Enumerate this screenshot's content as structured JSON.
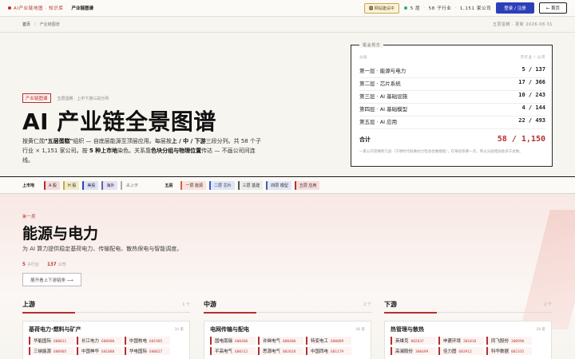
{
  "topbar": {
    "brand": "AI产业链地图 · 知识库",
    "map_label": "产业链图谱",
    "live_badge": "🅼 网站建设中",
    "stats": [
      "5 层",
      "58 子行业",
      "1,151 家公司"
    ],
    "login_label": "登录 / 注册",
    "back_label": "← 首页"
  },
  "breadcrumb": {
    "home": "首页",
    "current": "产业链图谱",
    "right": "五层蛋糕 · 更新 2026·08·31"
  },
  "hero": {
    "tag": "产业链图谱",
    "subtitle": "五层蛋糕 · 上中下游三段分列",
    "title": "AI 产业链全景图谱",
    "desc_parts": [
      "按黄仁勋",
      "\"五层蛋糕\"",
      "组织 — 自底层能源至顶层应用。每层按",
      "上 / 中 / 下游",
      "三段分列。共 58 个子行业 × 1,151 家公司。按 ",
      "5 种上市地",
      "染色。关系靠",
      "色块分组与物理位置",
      "传达 — 不画公司间连线。"
    ]
  },
  "card": {
    "label": "覆盖概览",
    "head_left": "分层",
    "head_right": "子行业 / 公司",
    "rows": [
      {
        "name": "第一层 · 能源与电力",
        "value": "5 / 137"
      },
      {
        "name": "第二层 · 芯片系统",
        "value": "17 / 366"
      },
      {
        "name": "第三层 · AI 基础设施",
        "value": "10 / 243"
      },
      {
        "name": "第四层 · AI 基础模型",
        "value": "4 / 144"
      },
      {
        "name": "第五层 · AI 应用",
        "value": "22 / 493"
      }
    ],
    "total_label": "合计",
    "total_value": "58 / 1,150",
    "note": "一家公司常横跨几层（宁德时代既做动力电池也做储能），在每层各算一次，所以分层相加会多于总数。"
  },
  "filter": {
    "market_title": "上市地",
    "markets": [
      "A 股",
      "H 股",
      "美股",
      "海外",
      "未上市"
    ],
    "layer_title": "五层",
    "layers": [
      "一层 能源",
      "二层 芯片",
      "三层 基建",
      "四层 模型",
      "五层 应用"
    ]
  },
  "section": {
    "kicker": "第一层",
    "title": "能源与电力",
    "desc": "为 AI 算力提供稳定基荷电力、传输配电、散热保电与智能调度。",
    "sub_count": "5",
    "sub_label": "子行业",
    "co_count": "137",
    "co_label": "公司",
    "button": "展开看上下游链条 ⟶",
    "columns": [
      {
        "title": "上游",
        "count": "1 个",
        "group": {
          "title": "基荷电力·燃料与矿产",
          "num": "34 家",
          "companies": [
            {
              "name": "华能国际",
              "code": "600011"
            },
            {
              "name": "长江电力",
              "code": "600900"
            },
            {
              "name": "中国核电",
              "code": "601985"
            },
            {
              "name": "三峡能源",
              "code": "600905"
            },
            {
              "name": "中国神华",
              "code": "601088"
            },
            {
              "name": "华电国际",
              "code": "600027"
            }
          ]
        }
      },
      {
        "title": "中游",
        "count": "2 个",
        "group": {
          "title": "电网传输与配电",
          "num": "48 家",
          "companies": [
            {
              "name": "国电南瑞",
              "code": "600406"
            },
            {
              "name": "许继电气",
              "code": "000400"
            },
            {
              "name": "特变电工",
              "code": "600089"
            },
            {
              "name": "平高电气",
              "code": "600312"
            },
            {
              "name": "思源电气",
              "code": "002028"
            },
            {
              "name": "中国西电",
              "code": "601179"
            }
          ]
        }
      },
      {
        "title": "下游",
        "count": "2 个",
        "group": {
          "title": "热管理与散热",
          "num": "28 家",
          "companies": [
            {
              "name": "英维克",
              "code": "002837"
            },
            {
              "name": "申菱环境",
              "code": "301018"
            },
            {
              "name": "同飞股份",
              "code": "300990"
            },
            {
              "name": "高澜股份",
              "code": "300499"
            },
            {
              "name": "佳力图",
              "code": "603912"
            },
            {
              "name": "科华数据",
              "code": "002335"
            }
          ]
        }
      }
    ]
  },
  "colors": {
    "accent": "#b5302e",
    "primary": "#2c3fb8",
    "background": "#f7f5f0"
  }
}
